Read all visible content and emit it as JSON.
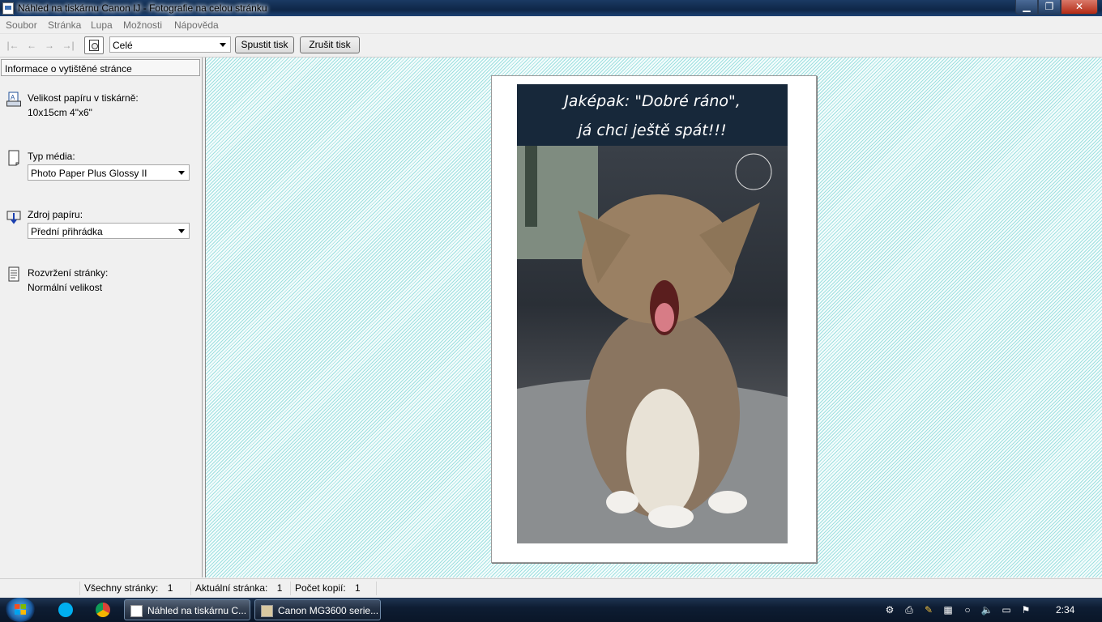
{
  "window": {
    "title": "Náhled na tiskárnu Canon IJ - Fotografie na celou stránku"
  },
  "menu": [
    "Soubor",
    "Stránka",
    "Lupa",
    "Možnosti",
    "Nápověda"
  ],
  "toolbar": {
    "zoom_value": "Celé",
    "print_button": "Spustit tisk",
    "cancel_button": "Zrušit tisk"
  },
  "info_panel": {
    "header": "Informace o vytištěné stránce",
    "paper_size_label": "Velikost papíru v tiskárně:",
    "paper_size_value": "10x15cm 4\"x6\"",
    "media_type_label": "Typ média:",
    "media_type_value": "Photo Paper Plus Glossy II",
    "paper_source_label": "Zdroj papíru:",
    "paper_source_value": "Přední přihrádka",
    "layout_label": "Rozvržení stránky:",
    "layout_value": "Normální velikost"
  },
  "preview": {
    "caption_line1": "Jaképak: \"Dobré ráno\",",
    "caption_line2": "já chci ještě spát!!!"
  },
  "status": {
    "all_pages_label": "Všechny stránky:",
    "all_pages_value": "1",
    "current_page_label": "Aktuální stránka:",
    "current_page_value": "1",
    "copies_label": "Počet kopií:",
    "copies_value": "1"
  },
  "taskbar": {
    "task1": "Náhled na tiskárnu C...",
    "task2": "Canon MG3600 serie...",
    "clock": "2:34"
  }
}
